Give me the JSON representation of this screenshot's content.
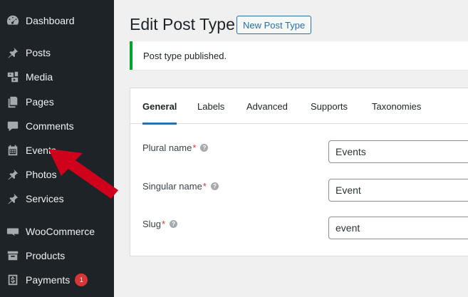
{
  "sidebar": {
    "items": [
      {
        "label": "Dashboard",
        "icon": "dashboard-icon"
      },
      {
        "label": "Posts",
        "icon": "pin-icon"
      },
      {
        "label": "Media",
        "icon": "media-icon"
      },
      {
        "label": "Pages",
        "icon": "pages-icon"
      },
      {
        "label": "Comments",
        "icon": "comment-icon"
      },
      {
        "label": "Events",
        "icon": "calendar-icon"
      },
      {
        "label": "Photos",
        "icon": "pin-icon"
      },
      {
        "label": "Services",
        "icon": "pin-icon"
      },
      {
        "label": "WooCommerce",
        "icon": "woo-icon"
      },
      {
        "label": "Products",
        "icon": "archive-icon"
      },
      {
        "label": "Payments",
        "icon": "dollar-icon",
        "badge": "1"
      }
    ]
  },
  "header": {
    "title": "Edit Post Type",
    "new_button": "New Post Type"
  },
  "notice": {
    "text": "Post type published.",
    "color": "#00a32a"
  },
  "tabs": [
    {
      "label": "General",
      "active": true
    },
    {
      "label": "Labels"
    },
    {
      "label": "Advanced"
    },
    {
      "label": "Supports"
    },
    {
      "label": "Taxonomies"
    }
  ],
  "fields": [
    {
      "label": "Plural name",
      "required": "*",
      "value": "Events"
    },
    {
      "label": "Singular name",
      "required": "*",
      "value": "Event"
    },
    {
      "label": "Slug",
      "required": "*",
      "value": "event"
    }
  ],
  "help_glyph": "?",
  "colors": {
    "accent": "#2271b1",
    "sidebar_bg": "#1d2327",
    "arrow": "#d0021b"
  }
}
